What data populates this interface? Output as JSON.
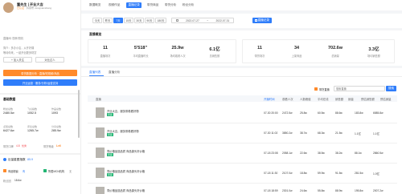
{
  "profile": {
    "name": "董先生 | 开业大吉",
    "badge": "已认证",
    "meta1": "抖音号: dongxiansheng",
    "meta2": "直播间: 厨房/厨具",
    "desc1": "简介：多办小店，从开好课",
    "desc2": "等待你来，一起开创更多财富",
    "follow_label": "+ 加入关注",
    "compare_label": "对比达人",
    "banner1": "带货数据分析 · 直播/短视频/商品",
    "banner2": "开业运营 · 服务/分析/运营支持"
  },
  "basic": {
    "title": "基础数据",
    "items": [
      {
        "label": "粉丝总数",
        "value": "2480.5w"
      },
      {
        "label": "飞瓜指数",
        "value": "1052.5"
      },
      {
        "label": "作品总数",
        "value": "1093"
      },
      {
        "label": "点赞总数",
        "value": "6427.6w"
      },
      {
        "label": "评论总数",
        "value": "1265.7w"
      },
      {
        "label": "分享总数",
        "value": "285.9w"
      }
    ],
    "rank_label": "带货口碑",
    "rank_value": "4.8",
    "rank_tag": "优秀",
    "level_label": "带货等级",
    "level_value": "Lv6"
  },
  "shop": {
    "title": "巨量星图指数",
    "title_value": "85.9",
    "row1": "商品橱窗",
    "row1_value": "有",
    "row2": "所属MCN机构",
    "row2_value": "无",
    "row3_label": "粉丝团",
    "row3_value": "18.6w"
  },
  "topnav": [
    "数据概览",
    "视频作品",
    "直播记录",
    "带货商品",
    "带货分析",
    "粉丝分析"
  ],
  "topnav_active": 2,
  "filters": {
    "ranges": [
      "今天",
      "昨天",
      "7天",
      "15天",
      "30天",
      "90天",
      "180天"
    ],
    "active": 2,
    "date_from": "2022-07-27",
    "date_sep": "~",
    "date_to": "2022-07-31",
    "export_label": "直播记录"
  },
  "summary": {
    "title": "直播概览",
    "stats": [
      {
        "value": "11",
        "label": "直播场次"
      },
      {
        "value": "5'518\"",
        "label": "平均直播时长"
      },
      {
        "value": "25.9w",
        "label": "场均观看人次"
      },
      {
        "value": "6.1亿",
        "label": "总销售额"
      },
      {
        "value": "11",
        "label": "带货场次"
      },
      {
        "value": "34",
        "label": "上架商品"
      },
      {
        "value": "702.6w",
        "label": "总销量"
      },
      {
        "value": "3.3亿",
        "label": "场均销售额"
      }
    ]
  },
  "list": {
    "tabs": [
      "直播列表",
      "直播分析"
    ],
    "active": 0,
    "search_placeholder": "搜索直播",
    "check_label": "带货直播",
    "search_btn": "搜索",
    "headers": [
      "直播",
      "开播时间",
      "观看人次",
      "人数峰值",
      "平均在线",
      "销售额",
      "销量",
      "预估销售额",
      "预估销量"
    ],
    "rows": [
      {
        "title": "开业大吉，服务带着看好物",
        "tag": "带货",
        "time": "07-30 20:00",
        "c1": "2472.5w",
        "c2": "25.8w",
        "c3": "60.5w",
        "c4": "88.6w",
        "c5": "183.8w",
        "c6": "6585.8w"
      },
      {
        "title": "开业大吉，服务带着看好物",
        "tag": "带货",
        "time": "07-30 11:02",
        "c1": "3850.2w",
        "c2": "38.7w",
        "c3": "68.3w",
        "c4": "21.5w",
        "c5": "1.1亿",
        "c6": "1.1亿"
      },
      {
        "title": "同价格品选品质 商品源头好价格",
        "tag": "带货",
        "time": "07-18 23:08",
        "c1": "2058.1w",
        "c2": "22.6w",
        "c3": "38.5w",
        "c4": "38.2w",
        "c5": "88.1w",
        "c6": "2860.5w"
      },
      {
        "title": "同价格品选品质 商品源头好价格",
        "tag": "带货",
        "time": "07-18 11:30",
        "c1": "2107.0w",
        "c2": "18.8w",
        "c3": "59.9w",
        "c4": "91.5w",
        "c5": "281.5w",
        "c6": "1.0亿"
      },
      {
        "title": "同价格品选品质 商品源头好价格",
        "tag": "带货",
        "time": "07-18 18:59",
        "c1": "2301.0w",
        "c2": "24.6w",
        "c3": "55.8w",
        "c4": "88.9w",
        "c5": "195.8w",
        "c6": "2007.2w"
      }
    ]
  },
  "colors": {
    "accent": "#2f7dfa",
    "orange": "#ff8a2b",
    "green": "#22b573",
    "red": "#f5474d"
  }
}
